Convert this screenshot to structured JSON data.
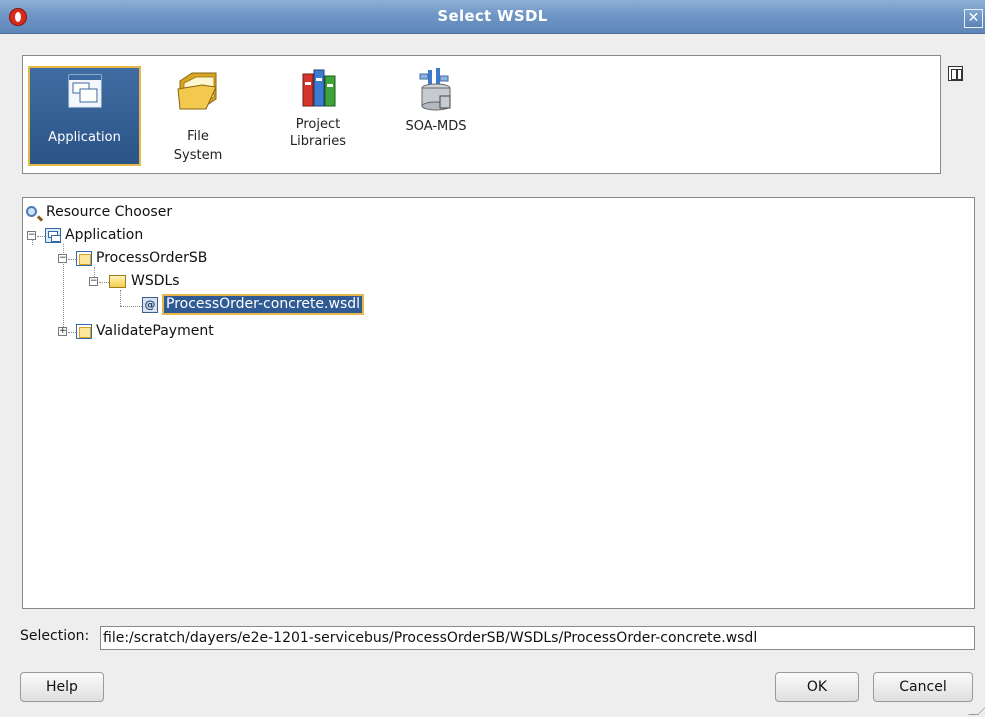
{
  "window": {
    "title": "Select WSDL",
    "close_glyph": "✕"
  },
  "locations": [
    {
      "label": "Application",
      "icon": "application-icon",
      "selected": true
    },
    {
      "label": "File\nSystem",
      "icon": "folder-icon",
      "selected": false
    },
    {
      "label": "Project\nLibraries",
      "icon": "books-icon",
      "selected": false
    },
    {
      "label": "SOA-MDS",
      "icon": "database-icon",
      "selected": false
    }
  ],
  "tree": {
    "root": "Resource Chooser",
    "application": "Application",
    "project1": "ProcessOrderSB",
    "folder": "WSDLs",
    "file": "ProcessOrder-concrete.wsdl",
    "file_glyph": "@",
    "project2": "ValidatePayment",
    "collapse_glyph": "−",
    "expand_glyph": "+"
  },
  "selection": {
    "label": "Selection:",
    "value": "file:/scratch/dayers/e2e-1201-servicebus/ProcessOrderSB/WSDLs/ProcessOrder-concrete.wsdl"
  },
  "buttons": {
    "help": "Help",
    "ok": "OK",
    "cancel": "Cancel"
  },
  "colors": {
    "titlebar": "#6f96c5",
    "selection_bg": "#2f5a93",
    "selection_border": "#e6b84a"
  }
}
